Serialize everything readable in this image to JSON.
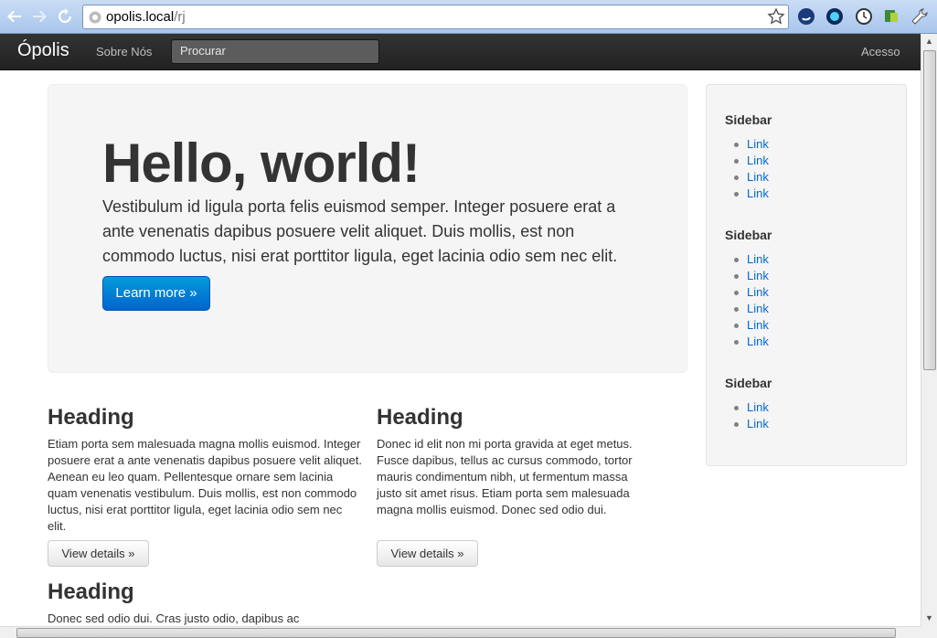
{
  "browser": {
    "url_host": "opolis.local",
    "url_path": "/rj"
  },
  "navbar": {
    "brand": "Ópolis",
    "about": "Sobre Nós",
    "search_placeholder": "Procurar",
    "login": "Acesso"
  },
  "hero": {
    "title": "Hello, world!",
    "text": "Vestibulum id ligula porta felis euismod semper. Integer posuere erat a ante venenatis dapibus posuere velit aliquet. Duis mollis, est non commodo luctus, nisi erat porttitor ligula, eget lacinia odio sem nec elit.",
    "button": "Learn more »"
  },
  "sidebar": {
    "sections": [
      {
        "title": "Sidebar",
        "links": [
          "Link",
          "Link",
          "Link",
          "Link"
        ]
      },
      {
        "title": "Sidebar",
        "links": [
          "Link",
          "Link",
          "Link",
          "Link",
          "Link",
          "Link"
        ]
      },
      {
        "title": "Sidebar",
        "links": [
          "Link",
          "Link"
        ]
      }
    ]
  },
  "columns": [
    {
      "heading": "Heading",
      "text": "Etiam porta sem malesuada magna mollis euismod. Integer posuere erat a ante venenatis dapibus posuere velit aliquet. Aenean eu leo quam. Pellentesque ornare sem lacinia quam venenatis vestibulum. Duis mollis, est non commodo luctus, nisi erat porttitor ligula, eget lacinia odio sem nec elit.",
      "button": "View details »"
    },
    {
      "heading": "Heading",
      "text": "Donec id elit non mi porta gravida at eget metus. Fusce dapibus, tellus ac cursus commodo, tortor mauris condimentum nibh, ut fermentum massa justo sit amet risus. Etiam porta sem malesuada magna mollis euismod. Donec sed odio dui.",
      "button": "View details »"
    },
    {
      "heading": "Heading",
      "text": "Donec sed odio dui. Cras justo odio, dapibus ac"
    }
  ]
}
